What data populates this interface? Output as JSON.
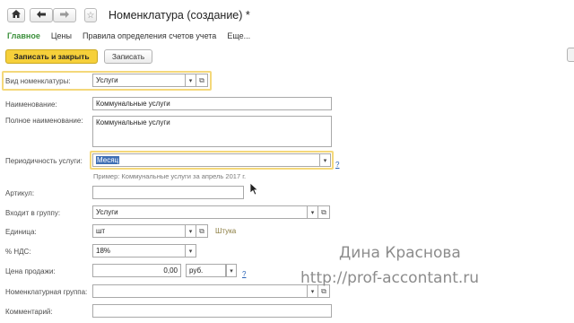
{
  "window": {
    "title": "Номенклатура (создание) *"
  },
  "nav": {
    "home_icon": "home-icon",
    "back_icon": "arrow-left-icon",
    "forward_icon": "arrow-right-icon"
  },
  "tabs": [
    {
      "label": "Главное",
      "active": true
    },
    {
      "label": "Цены",
      "active": false
    },
    {
      "label": "Правила определения счетов учета",
      "active": false
    },
    {
      "label": "Еще...",
      "active": false
    }
  ],
  "toolbar": {
    "save_close_label": "Записать и закрыть",
    "save_label": "Записать"
  },
  "form": {
    "type_label": "Вид номенклатуры:",
    "type_value": "Услуги",
    "name_label": "Наименование:",
    "name_value": "Коммунальные услуги",
    "full_name_label": "Полное наименование:",
    "full_name_value": "Коммунальные услуги",
    "periodicity_label": "Периодичность услуги:",
    "periodicity_value": "Месяц",
    "periodicity_help": "?",
    "periodicity_example": "Пример: Коммунальные услуги за апрель 2017 г.",
    "article_label": "Артикул:",
    "article_value": "",
    "group_label": "Входит в группу:",
    "group_value": "Услуги",
    "unit_label": "Единица:",
    "unit_value": "шт",
    "unit_full": "Штука",
    "vat_label": "% НДС:",
    "vat_value": "18%",
    "price_label": "Цена продажи:",
    "price_value": "0,00",
    "currency_value": "руб.",
    "price_help": "?",
    "nom_group_label": "Номенклатурная группа:",
    "nom_group_value": "",
    "comment_label": "Комментарий:",
    "comment_value": ""
  },
  "watermark": {
    "author": "Дина Краснова",
    "site": "http://prof-accontant.ru"
  }
}
